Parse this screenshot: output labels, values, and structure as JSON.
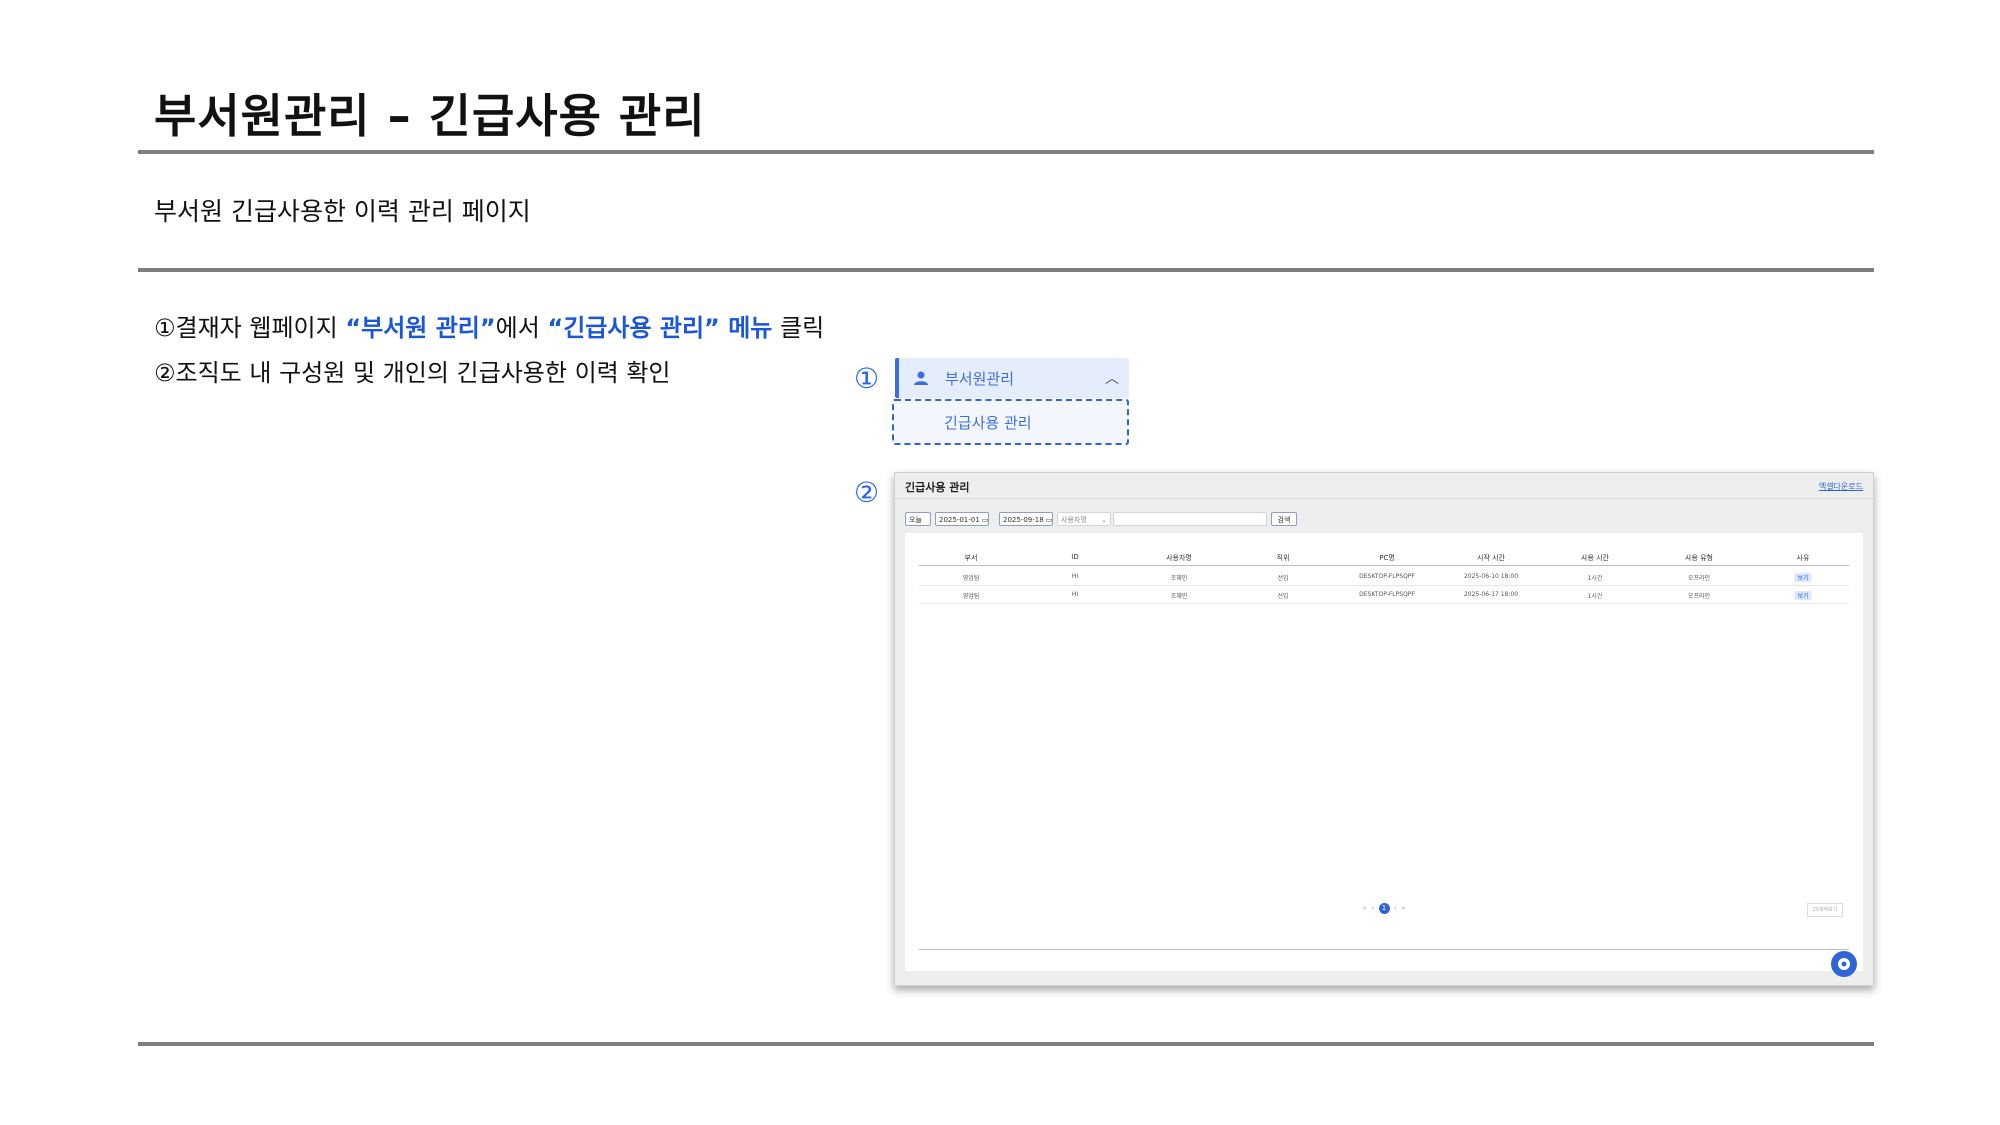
{
  "slide": {
    "title": "부서원관리 – 긴급사용 관리",
    "subtitle": "부서원 긴급사용한 이력 관리 페이지"
  },
  "steps": [
    {
      "num": "①",
      "pre": "결재자 웹페이지 ",
      "hl1": "“부서원 관리”",
      "mid": "에서 ",
      "hl2": "“긴급사용 관리” 메뉴",
      "post": " 클릭"
    },
    {
      "num": "②",
      "text": "조직도 내 구성원 및 개인의 긴급사용한 이력 확인"
    }
  ],
  "markers": [
    "①",
    "②"
  ],
  "menu": {
    "parent": "부서원관리",
    "child": "긴급사용 관리",
    "user_icon": "user-icon",
    "chevron_icon": "chevron-up-icon"
  },
  "app": {
    "title": "긴급사용 관리",
    "excel_link": "엑셀다운로드",
    "filters": {
      "today": "오늘",
      "start_date": "2025-01-01",
      "end_date": "2025-09-18",
      "search_type": "사용자명",
      "search_value": "",
      "search_button": "검색"
    },
    "columns": [
      "부서",
      "ID",
      "사용자명",
      "직위",
      "PC명",
      "시작 시간",
      "사용 시간",
      "사용 유형",
      "사유"
    ],
    "rows": [
      [
        "영업팀",
        "HI",
        "조혜민",
        "선임",
        "DESKTOP-FLPSQPF",
        "2025-06-10 18:00",
        "1시간",
        "오프라인",
        "보기"
      ],
      [
        "영업팀",
        "HI",
        "조혜민",
        "선임",
        "DESKTOP-FLPSQPF",
        "2025-06-17 18:00",
        "1시간",
        "오프라인",
        "보기"
      ]
    ],
    "pagination": {
      "current": "1"
    },
    "per_page": "20개씩보기"
  },
  "colors": {
    "accent": "#1a56db",
    "rule": "#7f7f7f"
  }
}
